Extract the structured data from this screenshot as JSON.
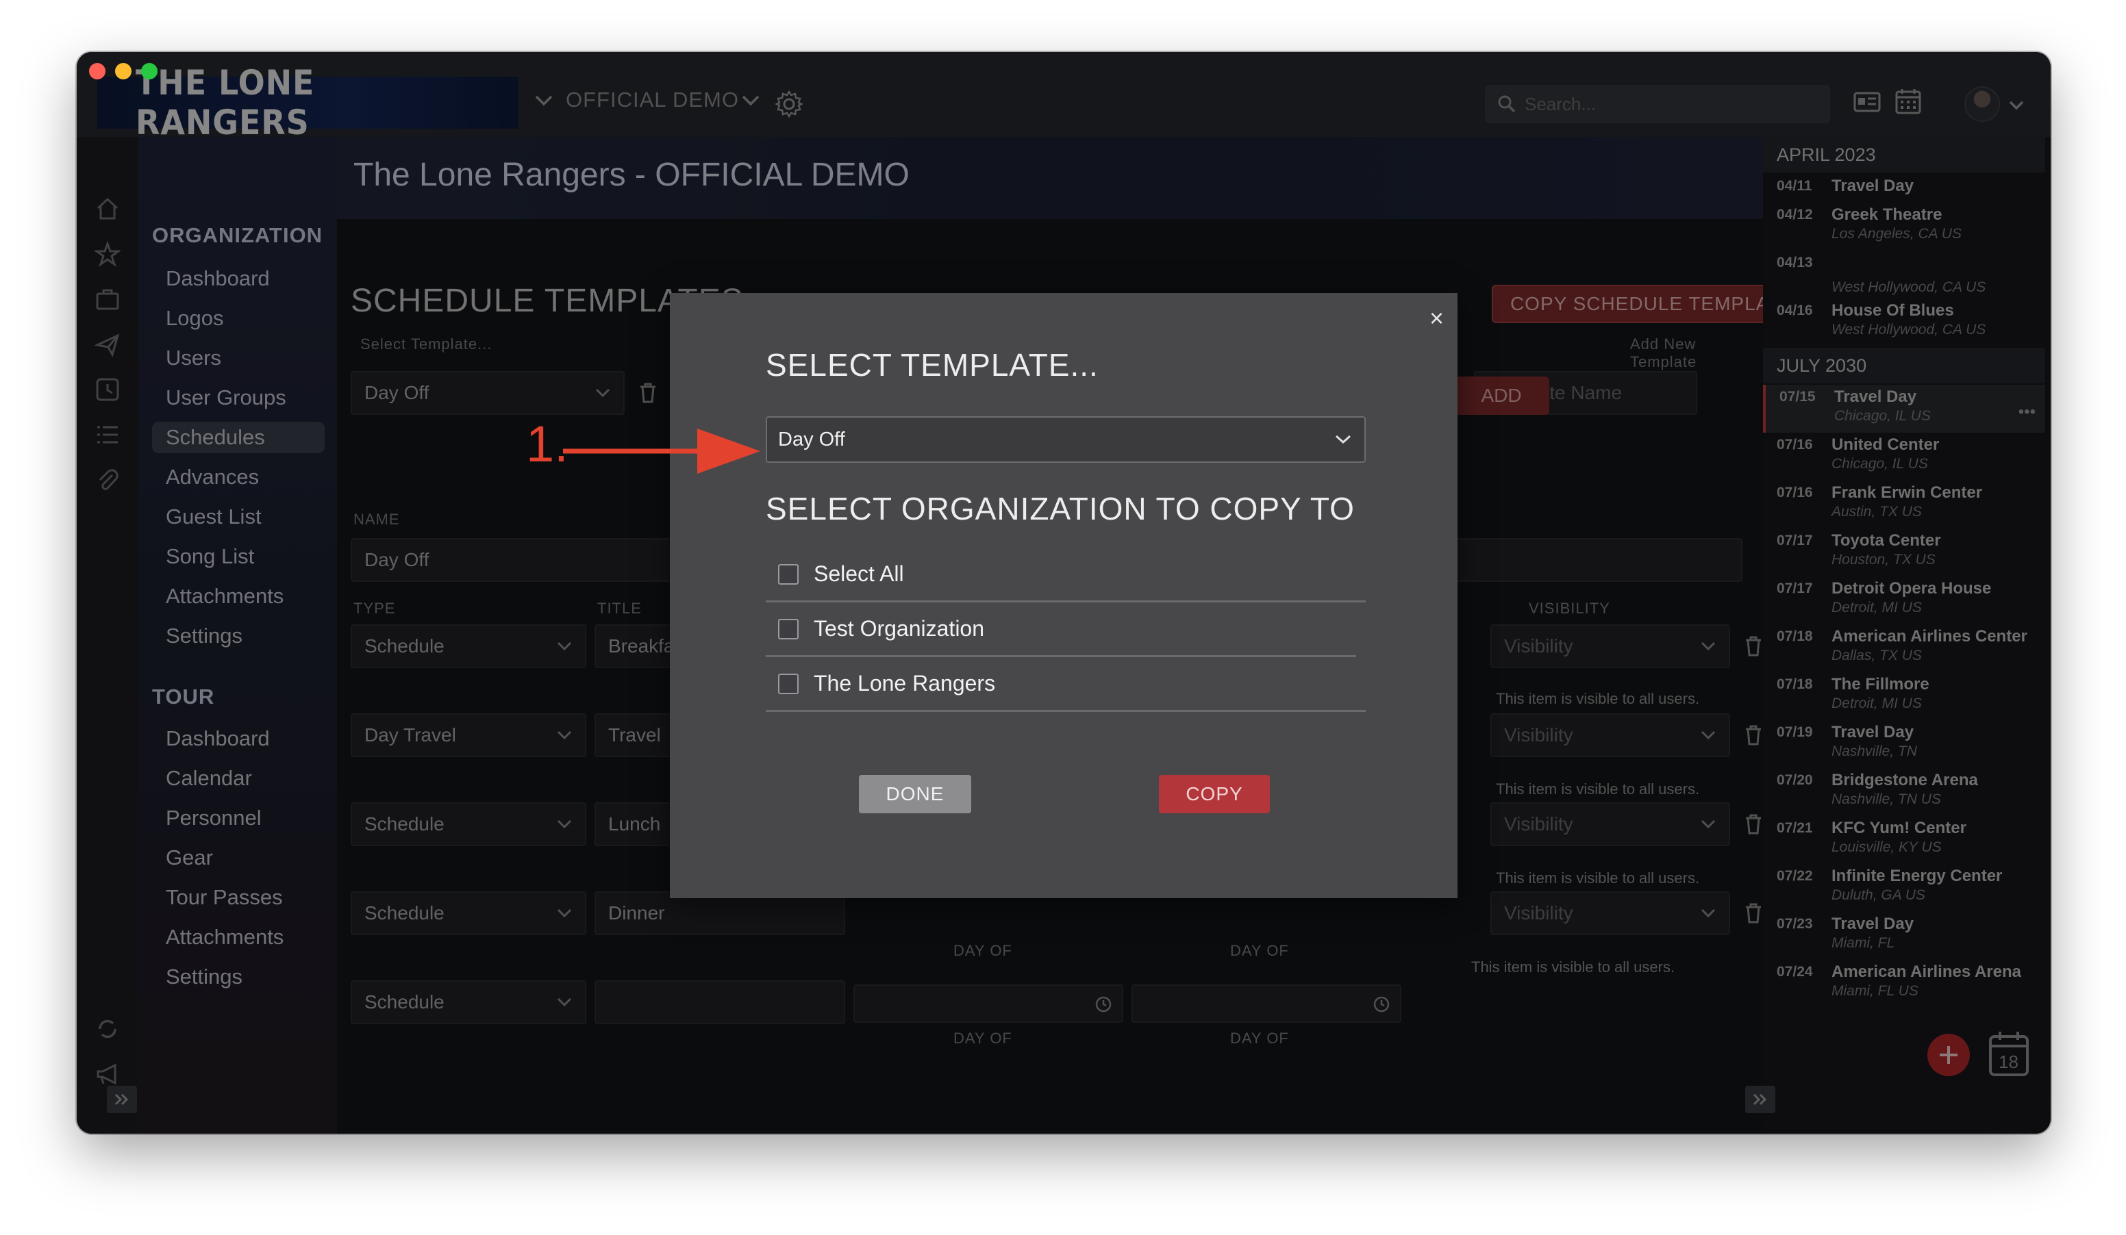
{
  "app": {
    "brand": "THE LONE RANGERS",
    "org_selector": "OFFICIAL DEMO",
    "search_placeholder": "Search..."
  },
  "nav": {
    "organization_heading": "ORGANIZATION",
    "organization_items": [
      "Dashboard",
      "Logos",
      "Users",
      "User Groups",
      "Schedules",
      "Advances",
      "Guest List",
      "Song List",
      "Attachments",
      "Settings"
    ],
    "active_item": "Schedules",
    "tour_heading": "TOUR",
    "tour_items": [
      "Dashboard",
      "Calendar",
      "Personnel",
      "Gear",
      "Tour Passes",
      "Attachments",
      "Settings"
    ]
  },
  "main": {
    "page_title": "The Lone Rangers - OFFICIAL DEMO",
    "section_title": "SCHEDULE TEMPLATES",
    "copy_template_button": "COPY SCHEDULE TEMPLATE",
    "select_template_label": "Select Template...",
    "selected_template": "Day Off",
    "add_new_template_label": "Add New Template",
    "template_name_placeholder": "Template Name",
    "add_button": "ADD",
    "name_label": "NAME",
    "name_value": "Day Off",
    "type_label": "TYPE",
    "title_label": "TITLE",
    "visibility_label": "VISIBILITY",
    "visibility_placeholder": "Visibility",
    "visibility_helper": "This item is visible to all users.",
    "day_of_label": "DAY OF",
    "rows": [
      {
        "type": "Schedule",
        "title": "Breakfast"
      },
      {
        "type": "Day Travel",
        "title": "Travel"
      },
      {
        "type": "Schedule",
        "title": "Lunch"
      },
      {
        "type": "Schedule",
        "title": "Dinner"
      },
      {
        "type": "Schedule",
        "title": ""
      }
    ]
  },
  "calendar": {
    "months": [
      {
        "label": "APRIL 2023",
        "events": [
          {
            "date": "04/11",
            "name": "Travel Day",
            "location": ""
          },
          {
            "date": "04/12",
            "name": "Greek Theatre",
            "location": "Los Angeles, CA US"
          },
          {
            "date": "04/13",
            "name": "",
            "location": "West Hollywood, CA US"
          },
          {
            "date": "04/16",
            "name": "House Of Blues",
            "location": "West Hollywood, CA US"
          }
        ]
      },
      {
        "label": "JULY 2030",
        "events": [
          {
            "date": "07/15",
            "name": "Travel Day",
            "location": "Chicago, IL US"
          },
          {
            "date": "07/16",
            "name": "United Center",
            "location": "Chicago, IL US"
          },
          {
            "date": "07/16",
            "name": "Frank Erwin Center",
            "location": "Austin, TX US"
          },
          {
            "date": "07/17",
            "name": "Toyota Center",
            "location": "Houston, TX US"
          },
          {
            "date": "07/17",
            "name": "Detroit Opera House",
            "location": "Detroit, MI US"
          },
          {
            "date": "07/18",
            "name": "American Airlines Center",
            "location": "Dallas, TX US"
          },
          {
            "date": "07/18",
            "name": "The Fillmore",
            "location": "Detroit, MI US"
          },
          {
            "date": "07/19",
            "name": "Travel Day",
            "location": "Nashville, TN"
          },
          {
            "date": "07/20",
            "name": "Bridgestone Arena",
            "location": "Nashville, TN US"
          },
          {
            "date": "07/21",
            "name": "KFC Yum! Center",
            "location": "Louisville, KY US"
          },
          {
            "date": "07/22",
            "name": "Infinite Energy Center",
            "location": "Duluth, GA US"
          },
          {
            "date": "07/23",
            "name": "Travel Day",
            "location": "Miami, FL"
          },
          {
            "date": "07/24",
            "name": "American Airlines Arena",
            "location": "Miami, FL US"
          }
        ]
      }
    ],
    "calendar_day": "18"
  },
  "modal": {
    "close": "×",
    "select_template_heading": "SELECT TEMPLATE...",
    "selected_template": "Day Off",
    "org_heading": "SELECT ORGANIZATION TO COPY TO",
    "options": [
      "Select All",
      "Test Organization",
      "The Lone Rangers"
    ],
    "done_button": "DONE",
    "copy_button": "COPY"
  },
  "annotation": {
    "step_label": "1.",
    "color": "#e2422e"
  },
  "colors": {
    "accent_red": "#b3363a",
    "background": "#141519",
    "modal_bg": "#48484b"
  }
}
